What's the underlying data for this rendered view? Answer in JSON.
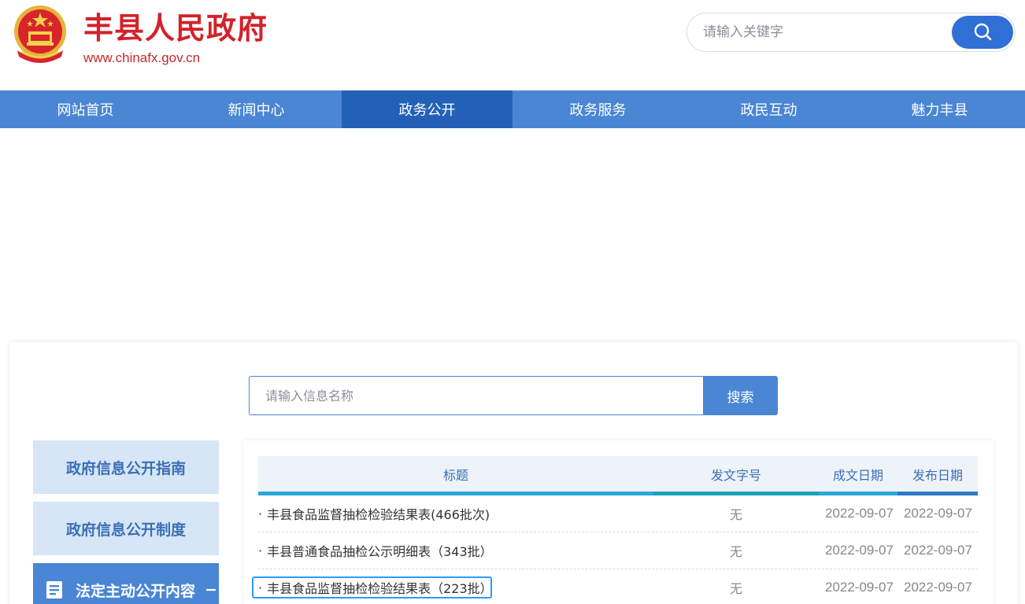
{
  "header": {
    "site_title": "丰县人民政府",
    "site_url": "www.chinafx.gov.cn",
    "search_placeholder": "请输入关键字"
  },
  "nav": {
    "items": [
      {
        "label": "网站首页",
        "active": false
      },
      {
        "label": "新闻中心",
        "active": false
      },
      {
        "label": "政务公开",
        "active": true
      },
      {
        "label": "政务服务",
        "active": false
      },
      {
        "label": "政民互动",
        "active": false
      },
      {
        "label": "魅力丰县",
        "active": false
      }
    ]
  },
  "info_search": {
    "placeholder": "请输入信息名称",
    "button_label": "搜索"
  },
  "sidebar": {
    "items": [
      {
        "label": "政府信息公开指南"
      },
      {
        "label": "政府信息公开制度"
      },
      {
        "label": "法定主动公开内容",
        "toggle": "−"
      }
    ]
  },
  "table": {
    "headers": [
      "标题",
      "发文字号",
      "成文日期",
      "发布日期"
    ],
    "rows": [
      {
        "title": "丰县食品监督抽检检验结果表(466批次)",
        "doc_no": "无",
        "written": "2022-09-07",
        "published": "2022-09-07"
      },
      {
        "title": "丰县普通食品抽检公示明细表（343批）",
        "doc_no": "无",
        "written": "2022-09-07",
        "published": "2022-09-07"
      },
      {
        "title": "丰县食品监督抽检检验结果表（223批）",
        "doc_no": "无",
        "written": "2022-09-07",
        "published": "2022-09-07"
      }
    ]
  },
  "colors": {
    "nav_bg": "#4a86d4",
    "nav_active": "#2361b8",
    "title_red": "#d3222a",
    "header_bar_1": "#2aa8d8",
    "header_bar_2": "#19a3b8",
    "header_bar_3": "#2aa8d8",
    "header_bar_4": "#2d7ac8"
  }
}
